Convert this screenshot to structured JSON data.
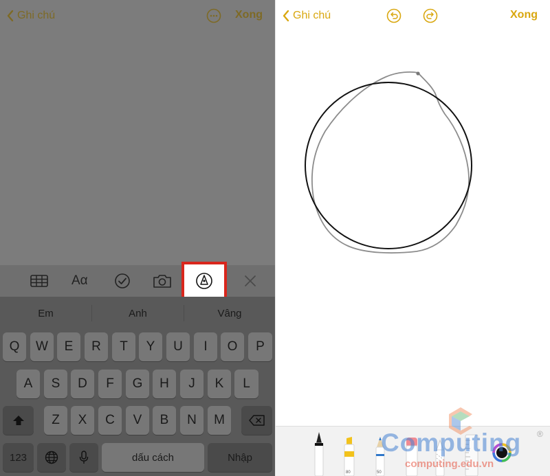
{
  "left_panel": {
    "nav": {
      "back_label": "Ghi chú",
      "more_icon": "ellipsis-circle-icon",
      "done_label": "Xong"
    },
    "toolbar": {
      "table_icon": "table-icon",
      "format_label": "Aα",
      "checklist_icon": "checkmark-circle-icon",
      "camera_icon": "camera-icon",
      "markup_icon": "pen-tip-circle-icon",
      "close_icon": "close-icon"
    },
    "suggestions": [
      "Em",
      "Anh",
      "Vâng"
    ],
    "keyboard": {
      "row1": [
        "Q",
        "W",
        "E",
        "R",
        "T",
        "Y",
        "U",
        "I",
        "O",
        "P"
      ],
      "row2": [
        "A",
        "S",
        "D",
        "F",
        "G",
        "H",
        "J",
        "K",
        "L"
      ],
      "row3": [
        "Z",
        "X",
        "C",
        "V",
        "B",
        "N",
        "M"
      ],
      "numbers_label": "123",
      "space_label": "dấu cách",
      "return_label": "Nhập"
    }
  },
  "right_panel": {
    "nav": {
      "back_label": "Ghi chú",
      "undo_icon": "undo-icon",
      "redo_icon": "redo-icon",
      "done_label": "Xong"
    },
    "tools": {
      "pen_icon": "pen-icon",
      "highlighter_icon": "highlighter-icon",
      "highlighter_value": "80",
      "pencil_icon": "pencil-icon",
      "pencil_value": "50",
      "eraser_icon": "eraser-icon",
      "lasso_icon": "lasso-icon",
      "ruler_icon": "ruler-icon",
      "color_picker_icon": "color-picker-icon"
    },
    "watermark": {
      "title": "Computing",
      "subtitle": "computing.edu.vn",
      "registered": "®"
    }
  },
  "colors": {
    "accent_dimmed": "#7e6a25",
    "accent": "#d9a70f",
    "highlight_border": "#d9261c"
  }
}
